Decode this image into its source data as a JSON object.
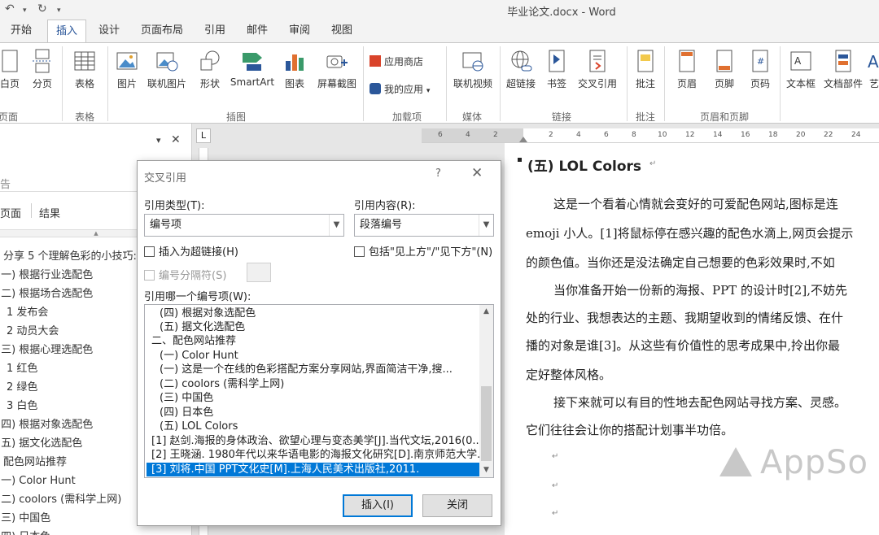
{
  "window": {
    "title": "毕业论文.docx - Word",
    "undo_icon": "↶",
    "redo_icon": "↻",
    "qa_menu_icon": "▾"
  },
  "tabs": [
    {
      "label": "开始"
    },
    {
      "label": "插入"
    },
    {
      "label": "设计"
    },
    {
      "label": "页面布局"
    },
    {
      "label": "引用"
    },
    {
      "label": "邮件"
    },
    {
      "label": "审阅"
    },
    {
      "label": "视图"
    }
  ],
  "ribbon": {
    "items": [
      {
        "label": "白页"
      },
      {
        "label": "分页"
      },
      {
        "label": "表格"
      },
      {
        "label": "图片"
      },
      {
        "label": "联机图片"
      },
      {
        "label": "形状"
      },
      {
        "label": "SmartArt"
      },
      {
        "label": "图表"
      },
      {
        "label": "屏幕截图"
      },
      {
        "label": "应用商店"
      },
      {
        "label": "我的应用"
      },
      {
        "label": "联机视频"
      },
      {
        "label": "超链接"
      },
      {
        "label": "书签"
      },
      {
        "label": "交叉引用"
      },
      {
        "label": "批注"
      },
      {
        "label": "页眉"
      },
      {
        "label": "页脚"
      },
      {
        "label": "页码"
      },
      {
        "label": "文本框"
      },
      {
        "label": "文档部件"
      },
      {
        "label": "艺"
      }
    ],
    "groups": [
      {
        "label": "页面"
      },
      {
        "label": "表格"
      },
      {
        "label": "插图"
      },
      {
        "label": "加载项"
      },
      {
        "label": "媒体"
      },
      {
        "label": "链接"
      },
      {
        "label": "批注"
      },
      {
        "label": "页眉和页脚"
      }
    ]
  },
  "nav": {
    "search_fragment": "告",
    "tab_pages": "页面",
    "tab_results": "结果",
    "pin_icon": "▾",
    "close_icon": "✕",
    "items": [
      "分享 5 个理解色彩的小技巧:",
      "(一) 根据行业选配色",
      "(二) 根据场合选配色",
      "1 发布会",
      "2 动员大会",
      "(三) 根据心理选配色",
      "1 红色",
      "2 绿色",
      "3 白色",
      "(四) 根据对象选配色",
      "(五) 据文化选配色",
      "配色网站推荐",
      "(一) Color Hunt",
      "(二) coolors (需科学上网)",
      "(三) 中国色",
      "(四) 日本色"
    ]
  },
  "ruler": {
    "corner": "L",
    "ticks": [
      "6",
      "4",
      "2",
      "2",
      "4",
      "6",
      "8",
      "10",
      "12",
      "14",
      "16",
      "18",
      "20",
      "22",
      "24"
    ]
  },
  "document": {
    "heading": "(五) LOL Colors",
    "lines": [
      "这是一个看着心情就会变好的可爱配色网站,图标是连",
      "emoji 小人。[1]将鼠标停在感兴趣的配色水滴上,网页会提示",
      "的颜色值。当你还是没法确定自己想要的色彩效果时,不如",
      "当你准备开始一份新的海报、PPT 的设计时[2],不妨先",
      "处的行业、我想表达的主题、我期望收到的情绪反馈、在什",
      "播的对象是谁[3]。从这些有价值性的思考成果中,拎出你最",
      "定好整体风格。",
      "接下来就可以有目的性地去配色网站寻找方案、灵感。",
      "它们往往会让你的搭配计划事半功倍。"
    ],
    "para_mark": "↵"
  },
  "dialog": {
    "title": "交叉引用",
    "help": "?",
    "close": "✕",
    "ref_type_label": "引用类型(T):",
    "ref_type_value": "编号项",
    "ref_content_label": "引用内容(R):",
    "ref_content_value": "段落编号",
    "insert_hyperlink": "插入为超链接(H)",
    "include_above_below": "包括\"见上方\"/\"见下方\"(N)",
    "separator_label": "编号分隔符(S)",
    "which_item_label": "引用哪一个编号项(W):",
    "list_items": [
      "(四) 根据对象选配色",
      "(五) 据文化选配色",
      "二、配色网站推荐",
      "(一) Color Hunt",
      "(一) 这是一个在线的色彩搭配方案分享网站,界面简洁干净,搜...",
      "(二) coolors (需科学上网)",
      "(三) 中国色",
      "(四) 日本色",
      "(五) LOL Colors",
      "[1] 赵剑.海报的身体政治、欲望心理与变态美学[J].当代文坛,2016(0...",
      "[2] 王晓涵. 1980年代以来华语电影的海报文化研究[D].南京师范大学...",
      "[3] 刘将.中国 PPT文化史[M].上海人民美术出版社,2011."
    ],
    "selected_index": 11,
    "insert_button": "插入(I)",
    "close_button": "关闭"
  },
  "watermark": {
    "text": "AppSo"
  }
}
